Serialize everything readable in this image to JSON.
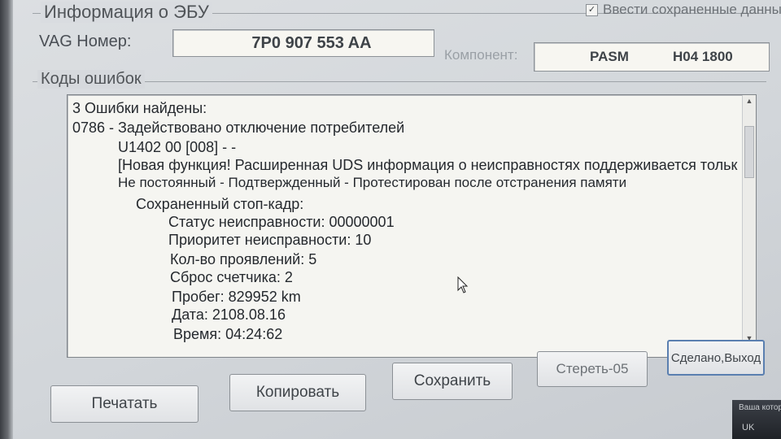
{
  "ecu_info": {
    "group_title": "Информация о ЭБУ",
    "saved_data_label": "Ввести сохраненные данные",
    "saved_data_checked": true,
    "vag_number_label": "VAG Номер:",
    "vag_number_value": "7P0 907 553 AA",
    "component_label": "Компонент:",
    "component_name": "PASM",
    "component_version": "H04 1800"
  },
  "fault_codes": {
    "group_title": "Коды ошибок",
    "lines": [
      "3 Ошибки найдены:",
      "0786 - Задействовано отключение потребителей",
      "U1402 00 [008] - -",
      "[Новая функция! Расширенная UDS информация о неисправностях поддерживается тольк",
      "Не постоянный - Подтвержденный - Протестирован после отстранения памяти",
      "Сохраненный стоп-кадр:",
      "Статус неисправности: 00000001",
      "Приоритет неисправности: 10",
      "Кол-во проявлений: 5",
      "Сброс счетчика: 2",
      "Пробег: 829952 km",
      "Дата: 2108.08.16",
      "Время: 04:24:62"
    ]
  },
  "buttons": {
    "print": "Печатать",
    "copy": "Копировать",
    "save": "Сохранить",
    "clear": "Стереть-05",
    "done": "Сделано,Выход"
  },
  "tray": {
    "top_text": "Ваша котора",
    "lang": "UK"
  }
}
